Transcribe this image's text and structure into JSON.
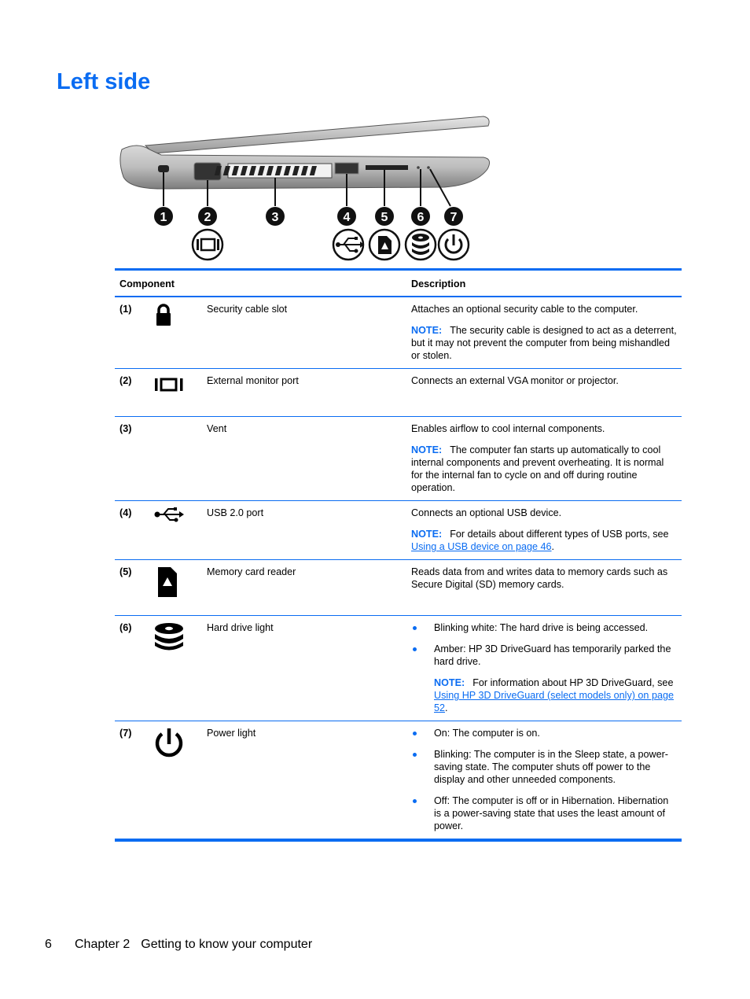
{
  "page": {
    "title": "Left side"
  },
  "figure": {
    "callouts": [
      "1",
      "2",
      "3",
      "4",
      "5",
      "6",
      "7"
    ],
    "callout_icons": [
      "none",
      "external-monitor-icon",
      "none",
      "usb-icon",
      "memory-card-icon",
      "hard-drive-icon",
      "power-icon"
    ]
  },
  "table": {
    "headers": {
      "component": "Component",
      "description": "Description"
    },
    "rows": [
      {
        "num": "(1)",
        "icon": "lock-icon",
        "name": "Security cable slot",
        "description": "Attaches an optional security cable to the computer.",
        "note_label": "NOTE:",
        "note": "The security cable is designed to act as a deterrent, but it may not prevent the computer from being mishandled or stolen."
      },
      {
        "num": "(2)",
        "icon": "external-monitor-icon",
        "name": "External monitor port",
        "description": "Connects an external VGA monitor or projector."
      },
      {
        "num": "(3)",
        "icon": "",
        "name": "Vent",
        "description": "Enables airflow to cool internal components.",
        "note_label": "NOTE:",
        "note": "The computer fan starts up automatically to cool internal components and prevent overheating. It is normal for the internal fan to cycle on and off during routine operation."
      },
      {
        "num": "(4)",
        "icon": "usb-icon",
        "name": "USB 2.0 port",
        "description": "Connects an optional USB device.",
        "note_label": "NOTE:",
        "note": "For details about different types of USB ports, see",
        "note_link": "Using a USB device on page 46",
        "note_end": "."
      },
      {
        "num": "(5)",
        "icon": "memory-card-icon",
        "name": "Memory card reader",
        "description": "Reads data from and writes data to memory cards such as Secure Digital (SD) memory cards."
      },
      {
        "num": "(6)",
        "icon": "hard-drive-icon",
        "name": "Hard drive light",
        "bullets": [
          "Blinking white: The hard drive is being accessed.",
          "Amber: HP 3D DriveGuard has temporarily parked the hard drive."
        ],
        "note_label": "NOTE:",
        "note": "For information about HP 3D DriveGuard, see",
        "note_link": "Using HP 3D DriveGuard (select models only) on page 52",
        "note_end": "."
      },
      {
        "num": "(7)",
        "icon": "power-icon",
        "name": "Power light",
        "bullets": [
          "On: The computer is on.",
          "Blinking: The computer is in the Sleep state, a power-saving state. The computer shuts off power to the display and other unneeded components.",
          "Off: The computer is off or in Hibernation. Hibernation is a power-saving state that uses the least amount of power."
        ]
      }
    ]
  },
  "footer": {
    "page_number": "6",
    "chapter": "Chapter 2",
    "chapter_title": "Getting to know your computer"
  },
  "colors": {
    "accent": "#0a6cf2",
    "text": "#000000"
  }
}
